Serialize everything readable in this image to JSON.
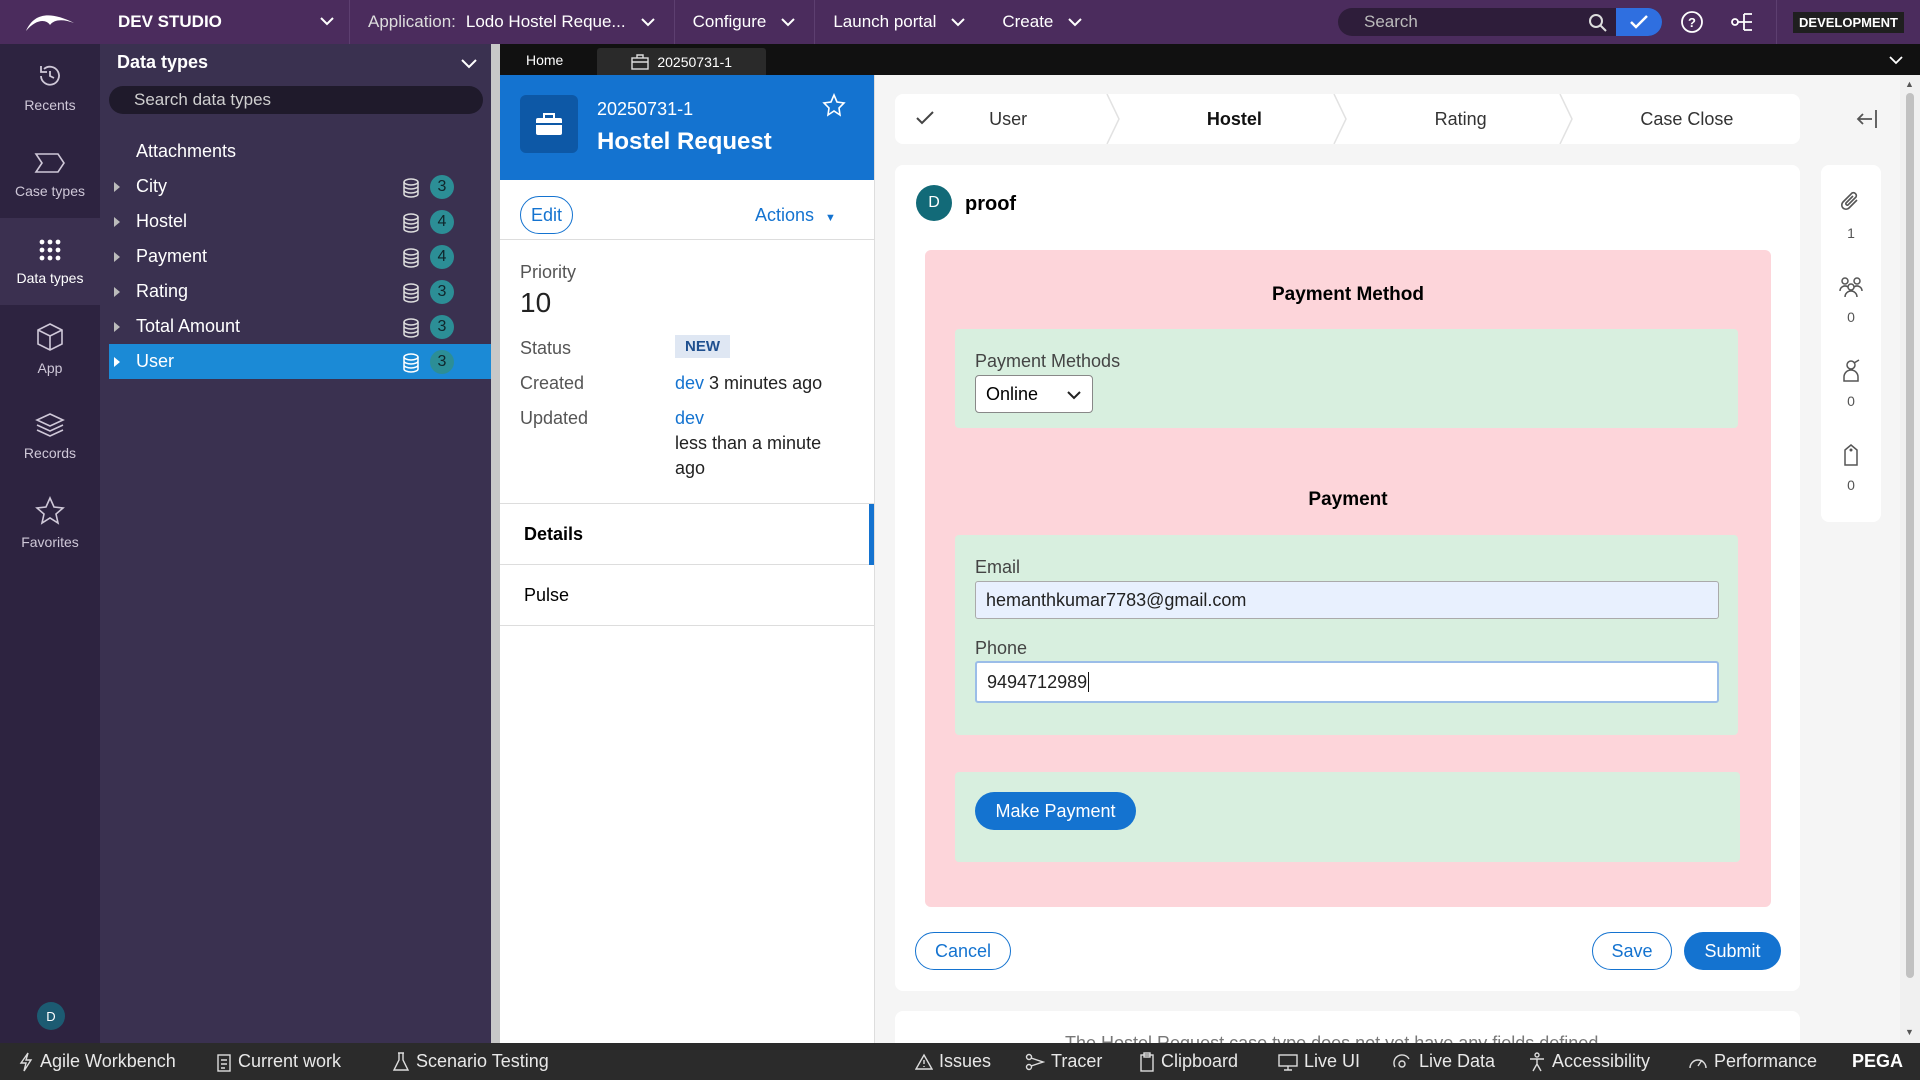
{
  "topbar": {
    "studio": "DEV STUDIO",
    "application_label": "Application:",
    "application_value": "Lodo Hostel Reque...",
    "configure": "Configure",
    "launch_portal": "Launch portal",
    "create": "Create",
    "search_placeholder": "Search",
    "environment": "DEVELOPMENT"
  },
  "rail": {
    "items": [
      {
        "label": "Recents",
        "icon": "history-icon"
      },
      {
        "label": "Case types",
        "icon": "case-type-icon"
      },
      {
        "label": "Data types",
        "icon": "grid-icon"
      },
      {
        "label": "App",
        "icon": "cube-icon"
      },
      {
        "label": "Records",
        "icon": "layers-icon"
      },
      {
        "label": "Favorites",
        "icon": "star-icon"
      }
    ],
    "avatar": "D"
  },
  "explorer": {
    "title": "Data types",
    "search_placeholder": "Search data types",
    "items": [
      {
        "label": "Attachments",
        "count": ""
      },
      {
        "label": "City",
        "count": "3"
      },
      {
        "label": "Hostel",
        "count": "4"
      },
      {
        "label": "Payment",
        "count": "4"
      },
      {
        "label": "Rating",
        "count": "3"
      },
      {
        "label": "Total Amount",
        "count": "3"
      },
      {
        "label": "User",
        "count": "3"
      }
    ]
  },
  "tabs": {
    "home": "Home",
    "case": "20250731-1"
  },
  "case": {
    "id": "20250731-1",
    "name": "Hostel Request",
    "edit": "Edit",
    "actions": "Actions",
    "priority_label": "Priority",
    "priority_value": "10",
    "status_label": "Status",
    "status_value": "NEW",
    "created_label": "Created",
    "created_by": "dev",
    "created_when": "3 minutes ago",
    "updated_label": "Updated",
    "updated_by": "dev",
    "updated_when_1": "less than a minute",
    "updated_when_2": "ago",
    "nav": [
      "Details",
      "Pulse"
    ]
  },
  "stages": [
    "User",
    "Hostel",
    "Rating",
    "Case Close"
  ],
  "form": {
    "avatar": "D",
    "title": "proof",
    "payment_method_title": "Payment Method",
    "payment_methods_label": "Payment Methods",
    "payment_methods_value": "Online",
    "payment_title": "Payment",
    "email_label": "Email",
    "email_value": "hemanthkumar7783@gmail.com",
    "phone_label": "Phone",
    "phone_value": "9494712989",
    "make_payment": "Make Payment",
    "cancel": "Cancel",
    "save": "Save",
    "submit": "Submit"
  },
  "card2_text": "The Hostel Request case type does not yet have any fields defined",
  "util": [
    {
      "icon": "paperclip-icon",
      "count": "1"
    },
    {
      "icon": "people-icon",
      "count": "0"
    },
    {
      "icon": "stakeholder-icon",
      "count": "0"
    },
    {
      "icon": "tag-icon",
      "count": "0"
    }
  ],
  "bottombar": {
    "left": [
      "Agile Workbench",
      "Current work",
      "Scenario Testing"
    ],
    "right": [
      "Issues",
      "Tracer",
      "Clipboard",
      "Live UI",
      "Live Data",
      "Accessibility",
      "Performance"
    ],
    "brand": "PEGA"
  }
}
